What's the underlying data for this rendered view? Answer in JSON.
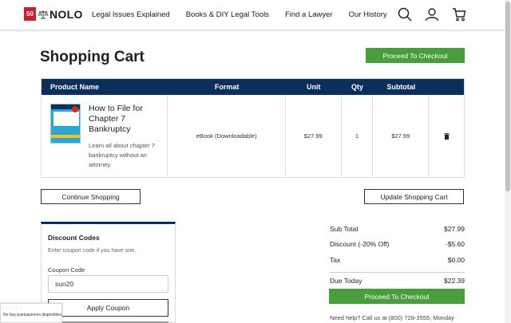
{
  "header": {
    "logo_badge": "50",
    "logo_text": "NOLO",
    "nav": [
      "Legal Issues Explained",
      "Books & DIY Legal Tools",
      "Find a Lawyer",
      "Our History"
    ],
    "icons": [
      "search-icon",
      "account-icon",
      "cart-icon"
    ]
  },
  "page": {
    "title": "Shopping Cart",
    "checkout_label": "Proceed To Checkout"
  },
  "table": {
    "headers": [
      "Product Name",
      "Format",
      "Unit",
      "Qty",
      "Subtotal"
    ],
    "rows": [
      {
        "product": "How to File for Chapter 7 Bankruptcy",
        "description": "Learn all about chapter 7 bankruptcy without an attorney.",
        "format": "eBook (Downloadable)",
        "unit": "$27.99",
        "qty": "1",
        "subtotal": "$27.99"
      }
    ]
  },
  "actions": {
    "continue_label": "Continue Shopping",
    "update_label": "Update Shopping Cart"
  },
  "discount": {
    "title": "Discount Codes",
    "subtitle": "Enter coupon code if you have one.",
    "coupon_label": "Coupon Code",
    "coupon_value": "sun20",
    "apply_label": "Apply Coupon"
  },
  "totals": {
    "subtotal_label": "Sub Total",
    "subtotal_value": "$27.99",
    "discount_label": "Discount (-20% Off)",
    "discount_value": "-$5.60",
    "tax_label": "Tax",
    "tax_value": "$0.00",
    "due_label": "Due Today",
    "due_value": "$22.39",
    "checkout_label": "Proceed To Checkout",
    "help_text": "Need help? Call us at (800) 728-3555, Monday"
  },
  "badge": {
    "stars": "☆☆☆☆☆",
    "text": "No hay puntuaciones disponibles"
  },
  "colors": {
    "brand_red": "#c8202f",
    "navy": "#0c2e5b",
    "green": "#4a9d3c"
  }
}
